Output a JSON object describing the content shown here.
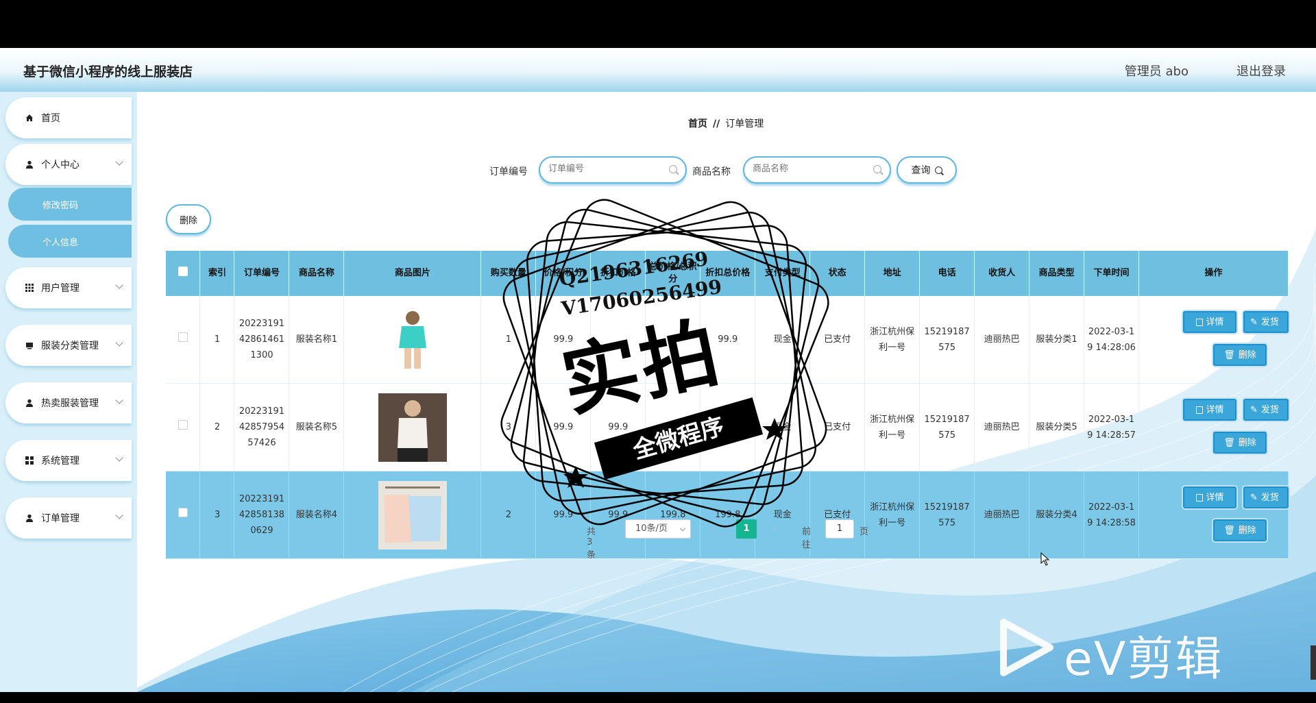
{
  "header": {
    "app_title": "基于微信小程序的线上服装店",
    "admin_label": "管理员 abo",
    "logout": "退出登录"
  },
  "sidebar": {
    "items": [
      {
        "label": "首页",
        "icon": "home-icon"
      },
      {
        "label": "个人中心",
        "icon": "user-icon"
      },
      {
        "label": "修改密码",
        "icon": ""
      },
      {
        "label": "个人信息",
        "icon": ""
      },
      {
        "label": "用户管理",
        "icon": "grid-icon"
      },
      {
        "label": "服装分类管理",
        "icon": "folder-icon"
      },
      {
        "label": "热卖服装管理",
        "icon": "user-icon"
      },
      {
        "label": "系统管理",
        "icon": "apps-icon"
      },
      {
        "label": "订单管理",
        "icon": "user-icon"
      }
    ]
  },
  "breadcrumb": {
    "home": "首页",
    "separator": "//",
    "current": "订单管理"
  },
  "search": {
    "order_no_label": "订单编号",
    "order_no_placeholder": "订单编号",
    "product_name_label": "商品名称",
    "product_name_placeholder": "商品名称",
    "query_label": "查询"
  },
  "toolbar": {
    "delete_label": "删除"
  },
  "table": {
    "columns": [
      "索引",
      "订单编号",
      "商品名称",
      "商品图片",
      "购买数量",
      "价格/积分",
      "折扣价格",
      "总价格/总积分",
      "折扣总价格",
      "支付类型",
      "状态",
      "地址",
      "电话",
      "收货人",
      "商品类型",
      "下单时间",
      "操作"
    ],
    "rows": [
      {
        "index": "1",
        "order_no": "20223191428614611300",
        "product": "服装名称1",
        "qty": "1",
        "price": "99.9",
        "discount": "",
        "total": "",
        "discount_total": "99.9",
        "pay": "现金",
        "status": "已支付",
        "address": "浙江杭州保利一号",
        "phone": "15219187575",
        "receiver": "迪丽热巴",
        "category": "服装分类1",
        "time": "2022-03-19 14:28:06"
      },
      {
        "index": "2",
        "order_no": "20223191428579545742​6",
        "product": "服装名称5",
        "qty": "3",
        "price": "99.9",
        "discount": "99.9",
        "total": "",
        "discount_total": "",
        "pay": "现金",
        "status": "已支付",
        "address": "浙江杭州保利一号",
        "phone": "15219187575",
        "receiver": "迪丽热巴",
        "category": "服装分类5",
        "time": "2022-03-19 14:28:57"
      },
      {
        "index": "3",
        "order_no": "20223191428581380629",
        "product": "服装名称4",
        "qty": "2",
        "price": "99.9",
        "discount": "99.9",
        "total": "199.8",
        "discount_total": "199.8",
        "pay": "现金",
        "status": "已支付",
        "address": "浙江杭州保利一号",
        "phone": "15219187575",
        "receiver": "迪丽热巴",
        "category": "服装分类4",
        "time": "2022-03-19 14:28:58"
      }
    ],
    "ops": {
      "detail": "详情",
      "ship": "发货",
      "delete": "删除"
    }
  },
  "pagination": {
    "total": "共 3 条",
    "page_size": "10条/页",
    "current_page": "1",
    "goto_label": "前往",
    "goto_value": "1",
    "page_suffix": "页"
  },
  "watermark": {
    "line1": "Q2196316269",
    "line2": "V17060256499",
    "big": "实拍",
    "ribbon": "全微程序",
    "ev_logo": "eV剪辑"
  },
  "colors": {
    "accent": "#6fc0e0",
    "button": "#3aa6da",
    "pager_active": "#15b592"
  }
}
